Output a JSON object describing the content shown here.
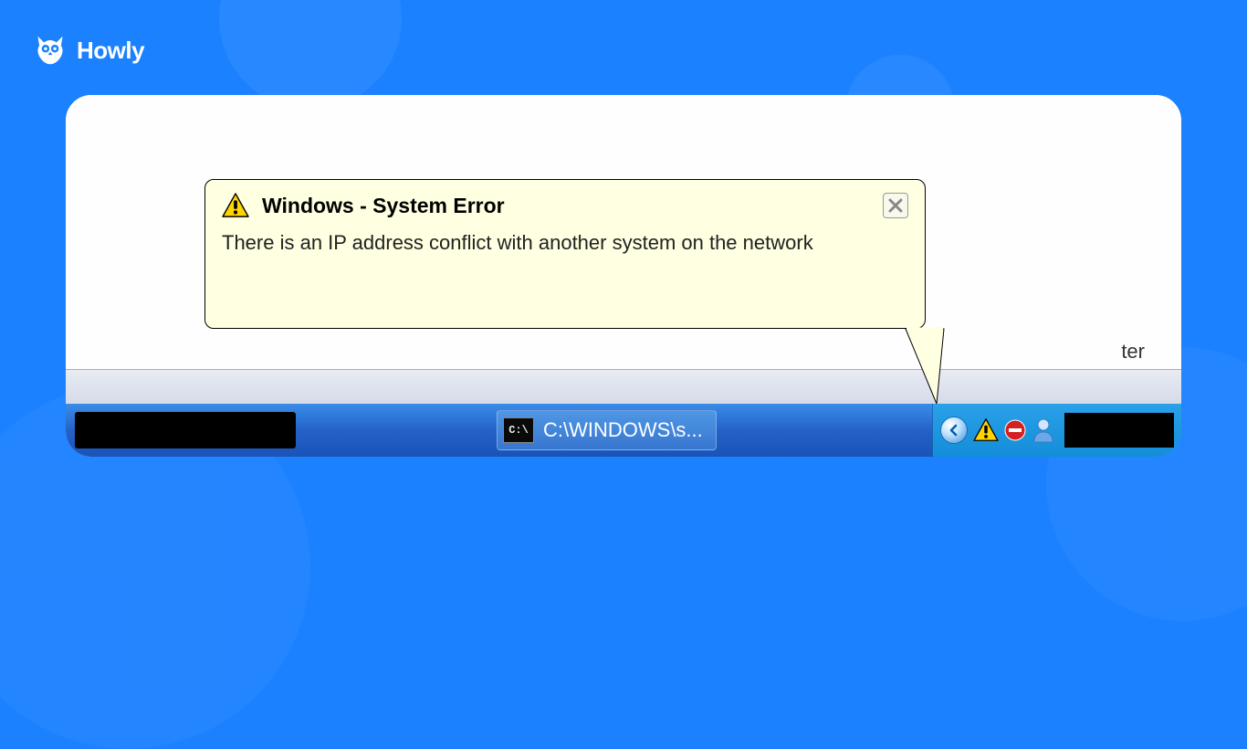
{
  "brand": {
    "name": "Howly"
  },
  "desktop": {
    "partial_text": "ter"
  },
  "balloon": {
    "title": "Windows - System Error",
    "message": "There is an IP address conflict with another system on the network"
  },
  "taskbar": {
    "cmd_icon_label": "C:\\",
    "cmd_label": "C:\\WINDOWS\\s..."
  }
}
